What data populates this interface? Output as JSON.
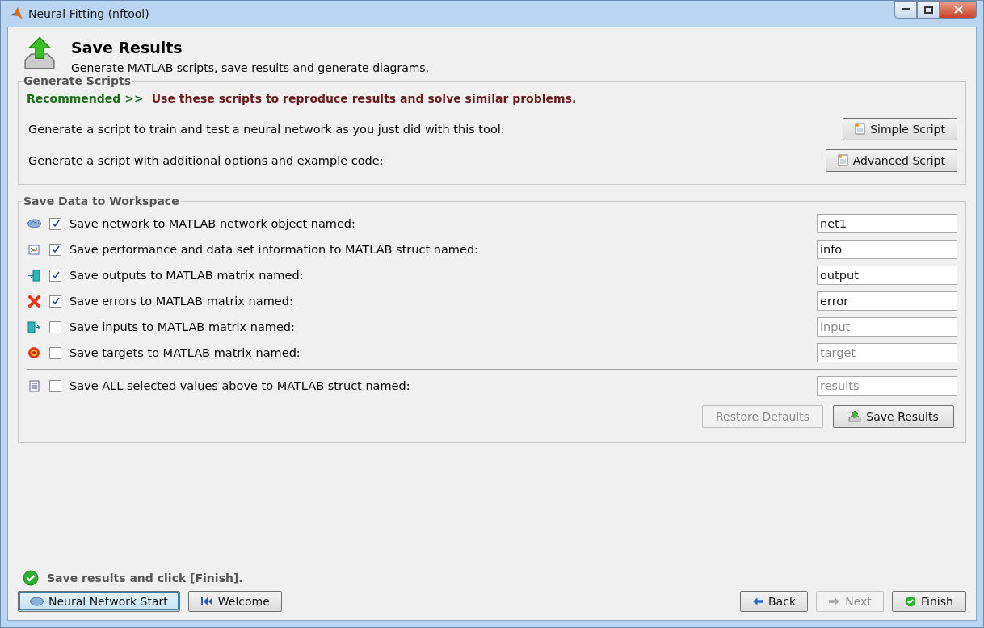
{
  "window": {
    "title": "Neural Fitting (nftool)"
  },
  "header": {
    "title": "Save Results",
    "subtitle": "Generate MATLAB scripts, save results and generate diagrams."
  },
  "generate_scripts": {
    "legend": "Generate Scripts",
    "recommended": "Recommended >>",
    "hint": "Use these scripts to reproduce results and solve similar problems.",
    "rows": [
      {
        "label": "Generate a script to train and test a neural network as you just did with this tool:",
        "button": "Simple Script"
      },
      {
        "label": "Generate a script with additional options and example code:",
        "button": "Advanced Script"
      }
    ]
  },
  "save_data": {
    "legend": "Save Data to Workspace",
    "rows": [
      {
        "label": "Save network to MATLAB network object named:",
        "checked": true,
        "value": "net1"
      },
      {
        "label": "Save performance and data set information to MATLAB struct named:",
        "checked": true,
        "value": "info"
      },
      {
        "label": "Save outputs to MATLAB matrix named:",
        "checked": true,
        "value": "output"
      },
      {
        "label": "Save errors to MATLAB matrix named:",
        "checked": true,
        "value": "error"
      },
      {
        "label": "Save inputs to MATLAB matrix named:",
        "checked": false,
        "value": "input"
      },
      {
        "label": "Save targets to MATLAB matrix named:",
        "checked": false,
        "value": "target"
      }
    ],
    "all_row": {
      "label": "Save ALL selected values above to MATLAB struct named:",
      "checked": false,
      "value": "results"
    },
    "buttons": [
      {
        "label": "Restore Defaults",
        "disabled": true
      },
      {
        "label": "Save Results",
        "disabled": false
      }
    ]
  },
  "status": "Save results and click [Finish].",
  "nav_left": [
    {
      "label": "Neural Network Start",
      "focused": true
    },
    {
      "label": "Welcome",
      "focused": false
    }
  ],
  "nav_right": [
    {
      "label": "Back",
      "disabled": false
    },
    {
      "label": "Next",
      "disabled": true
    },
    {
      "label": "Finish",
      "disabled": false
    }
  ]
}
